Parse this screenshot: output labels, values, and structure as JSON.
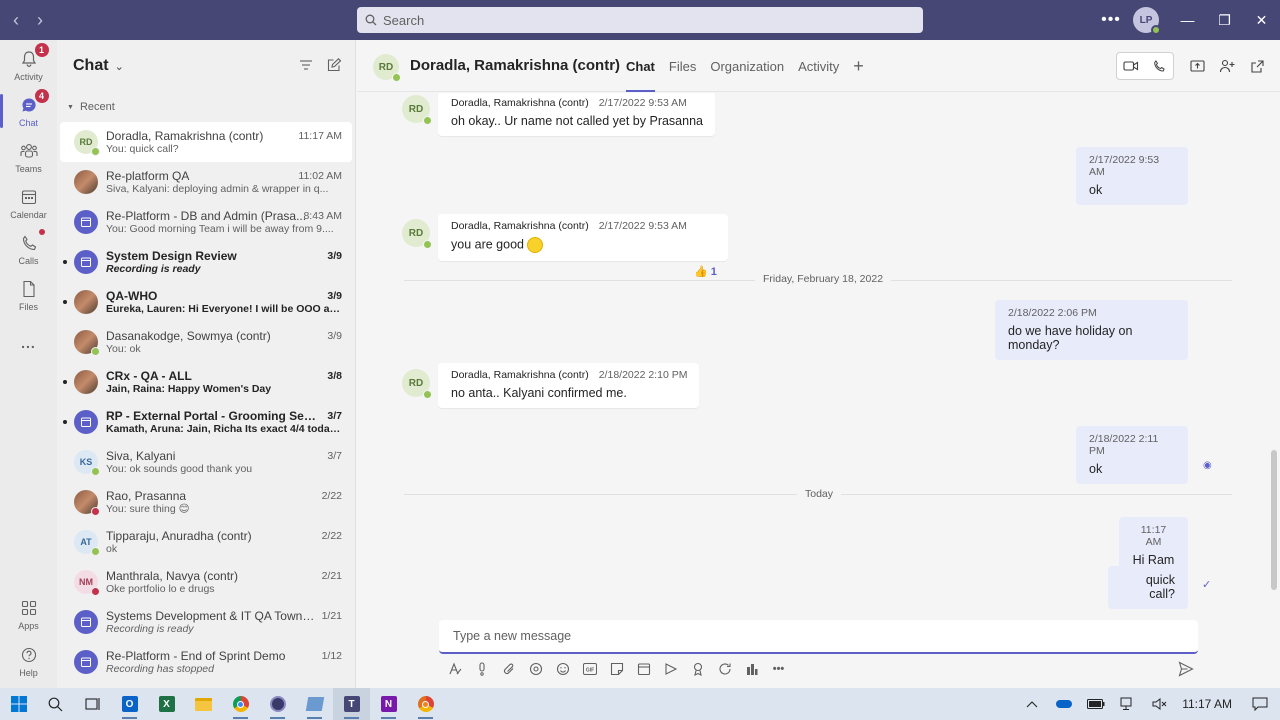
{
  "search": {
    "placeholder": "Search"
  },
  "user": {
    "initials": "LP"
  },
  "rail": [
    {
      "label": "Activity",
      "badge": "1"
    },
    {
      "label": "Chat",
      "badge": "4"
    },
    {
      "label": "Teams"
    },
    {
      "label": "Calendar"
    },
    {
      "label": "Calls"
    },
    {
      "label": "Files"
    },
    {
      "label": "..."
    },
    {
      "label": "Apps"
    },
    {
      "label": "Help"
    }
  ],
  "chatlist": {
    "title": "Chat",
    "section": "Recent",
    "items": [
      {
        "name": "Doradla, Ramakrishna (contr)",
        "time": "11:17 AM",
        "preview": "You: quick call?",
        "initials": "RD",
        "presence": "available"
      },
      {
        "name": "Re-platform QA",
        "time": "11:02 AM",
        "preview": "Siva, Kalyani: deploying admin & wrapper in q..."
      },
      {
        "name": "Re-Platform - DB and Admin (Prasa...",
        "time": "8:43 AM",
        "preview": "You: Good morning Team i will be away from 9...."
      },
      {
        "name": "System Design Review",
        "time": "3/9",
        "preview": "Recording is ready"
      },
      {
        "name": "QA-WHO",
        "time": "3/9",
        "preview": "Eureka, Lauren: Hi Everyone! I will be OOO all ..."
      },
      {
        "name": "Dasanakodge, Sowmya (contr)",
        "time": "3/9",
        "preview": "You: ok"
      },
      {
        "name": "CRx - QA - ALL",
        "time": "3/8",
        "preview": "Jain, Raina: Happy Women's Day"
      },
      {
        "name": "RP - External Portal - Grooming Sessi...",
        "time": "3/7",
        "preview": "Kamath, Aruna: Jain, Richa Its exact 4/4 today..."
      },
      {
        "name": "Siva, Kalyani",
        "time": "3/7",
        "preview": "You: ok sounds good thank you",
        "initials": "KS"
      },
      {
        "name": "Rao, Prasanna",
        "time": "2/22",
        "preview": "You: sure thing 😊"
      },
      {
        "name": "Tipparaju, Anuradha (contr)",
        "time": "2/22",
        "preview": "ok",
        "initials": "AT"
      },
      {
        "name": "Manthrala, Navya (contr)",
        "time": "2/21",
        "preview": "Oke portfolio lo e drugs",
        "initials": "NM"
      },
      {
        "name": "Systems Development & IT QA Town H...",
        "time": "1/21",
        "preview": "Recording is ready"
      },
      {
        "name": "Re-Platform - End of Sprint Demo",
        "time": "1/12",
        "preview": "Recording has stopped"
      }
    ]
  },
  "conversation": {
    "initials": "RD",
    "title": "Doradla, Ramakrishna (contr)",
    "tabs": [
      "Chat",
      "Files",
      "Organization",
      "Activity"
    ],
    "messages": [
      {
        "sender": "Doradla, Ramakrishna (contr)",
        "time": "2/17/2022 9:53 AM",
        "text": "oh okay.. Ur name not called yet by Prasanna"
      },
      {
        "time": "2/17/2022 9:53 AM",
        "text": "ok"
      },
      {
        "sender": "Doradla, Ramakrishna (contr)",
        "time": "2/17/2022 9:53 AM",
        "text": "you are good",
        "reaction_count": "1"
      },
      {
        "divider": "Friday, February 18, 2022"
      },
      {
        "time": "2/18/2022 2:06 PM",
        "text": "do we have holiday on monday?"
      },
      {
        "sender": "Doradla, Ramakrishna (contr)",
        "time": "2/18/2022 2:10 PM",
        "text": "no anta.. Kalyani confirmed me."
      },
      {
        "time": "2/18/2022 2:11 PM",
        "text": "ok"
      },
      {
        "divider": "Today"
      },
      {
        "time": "11:17 AM",
        "text": "Hi Ram"
      },
      {
        "text": "quick call?"
      }
    ]
  },
  "composer": {
    "placeholder": "Type a new message"
  },
  "taskbar": {
    "time": "11:17 AM"
  },
  "colors": {
    "brand": "#464775",
    "accent": "#5b5fc7",
    "outgoing_bubble": "#e8ebfa",
    "available": "#92c353",
    "busy": "#c4314b"
  }
}
